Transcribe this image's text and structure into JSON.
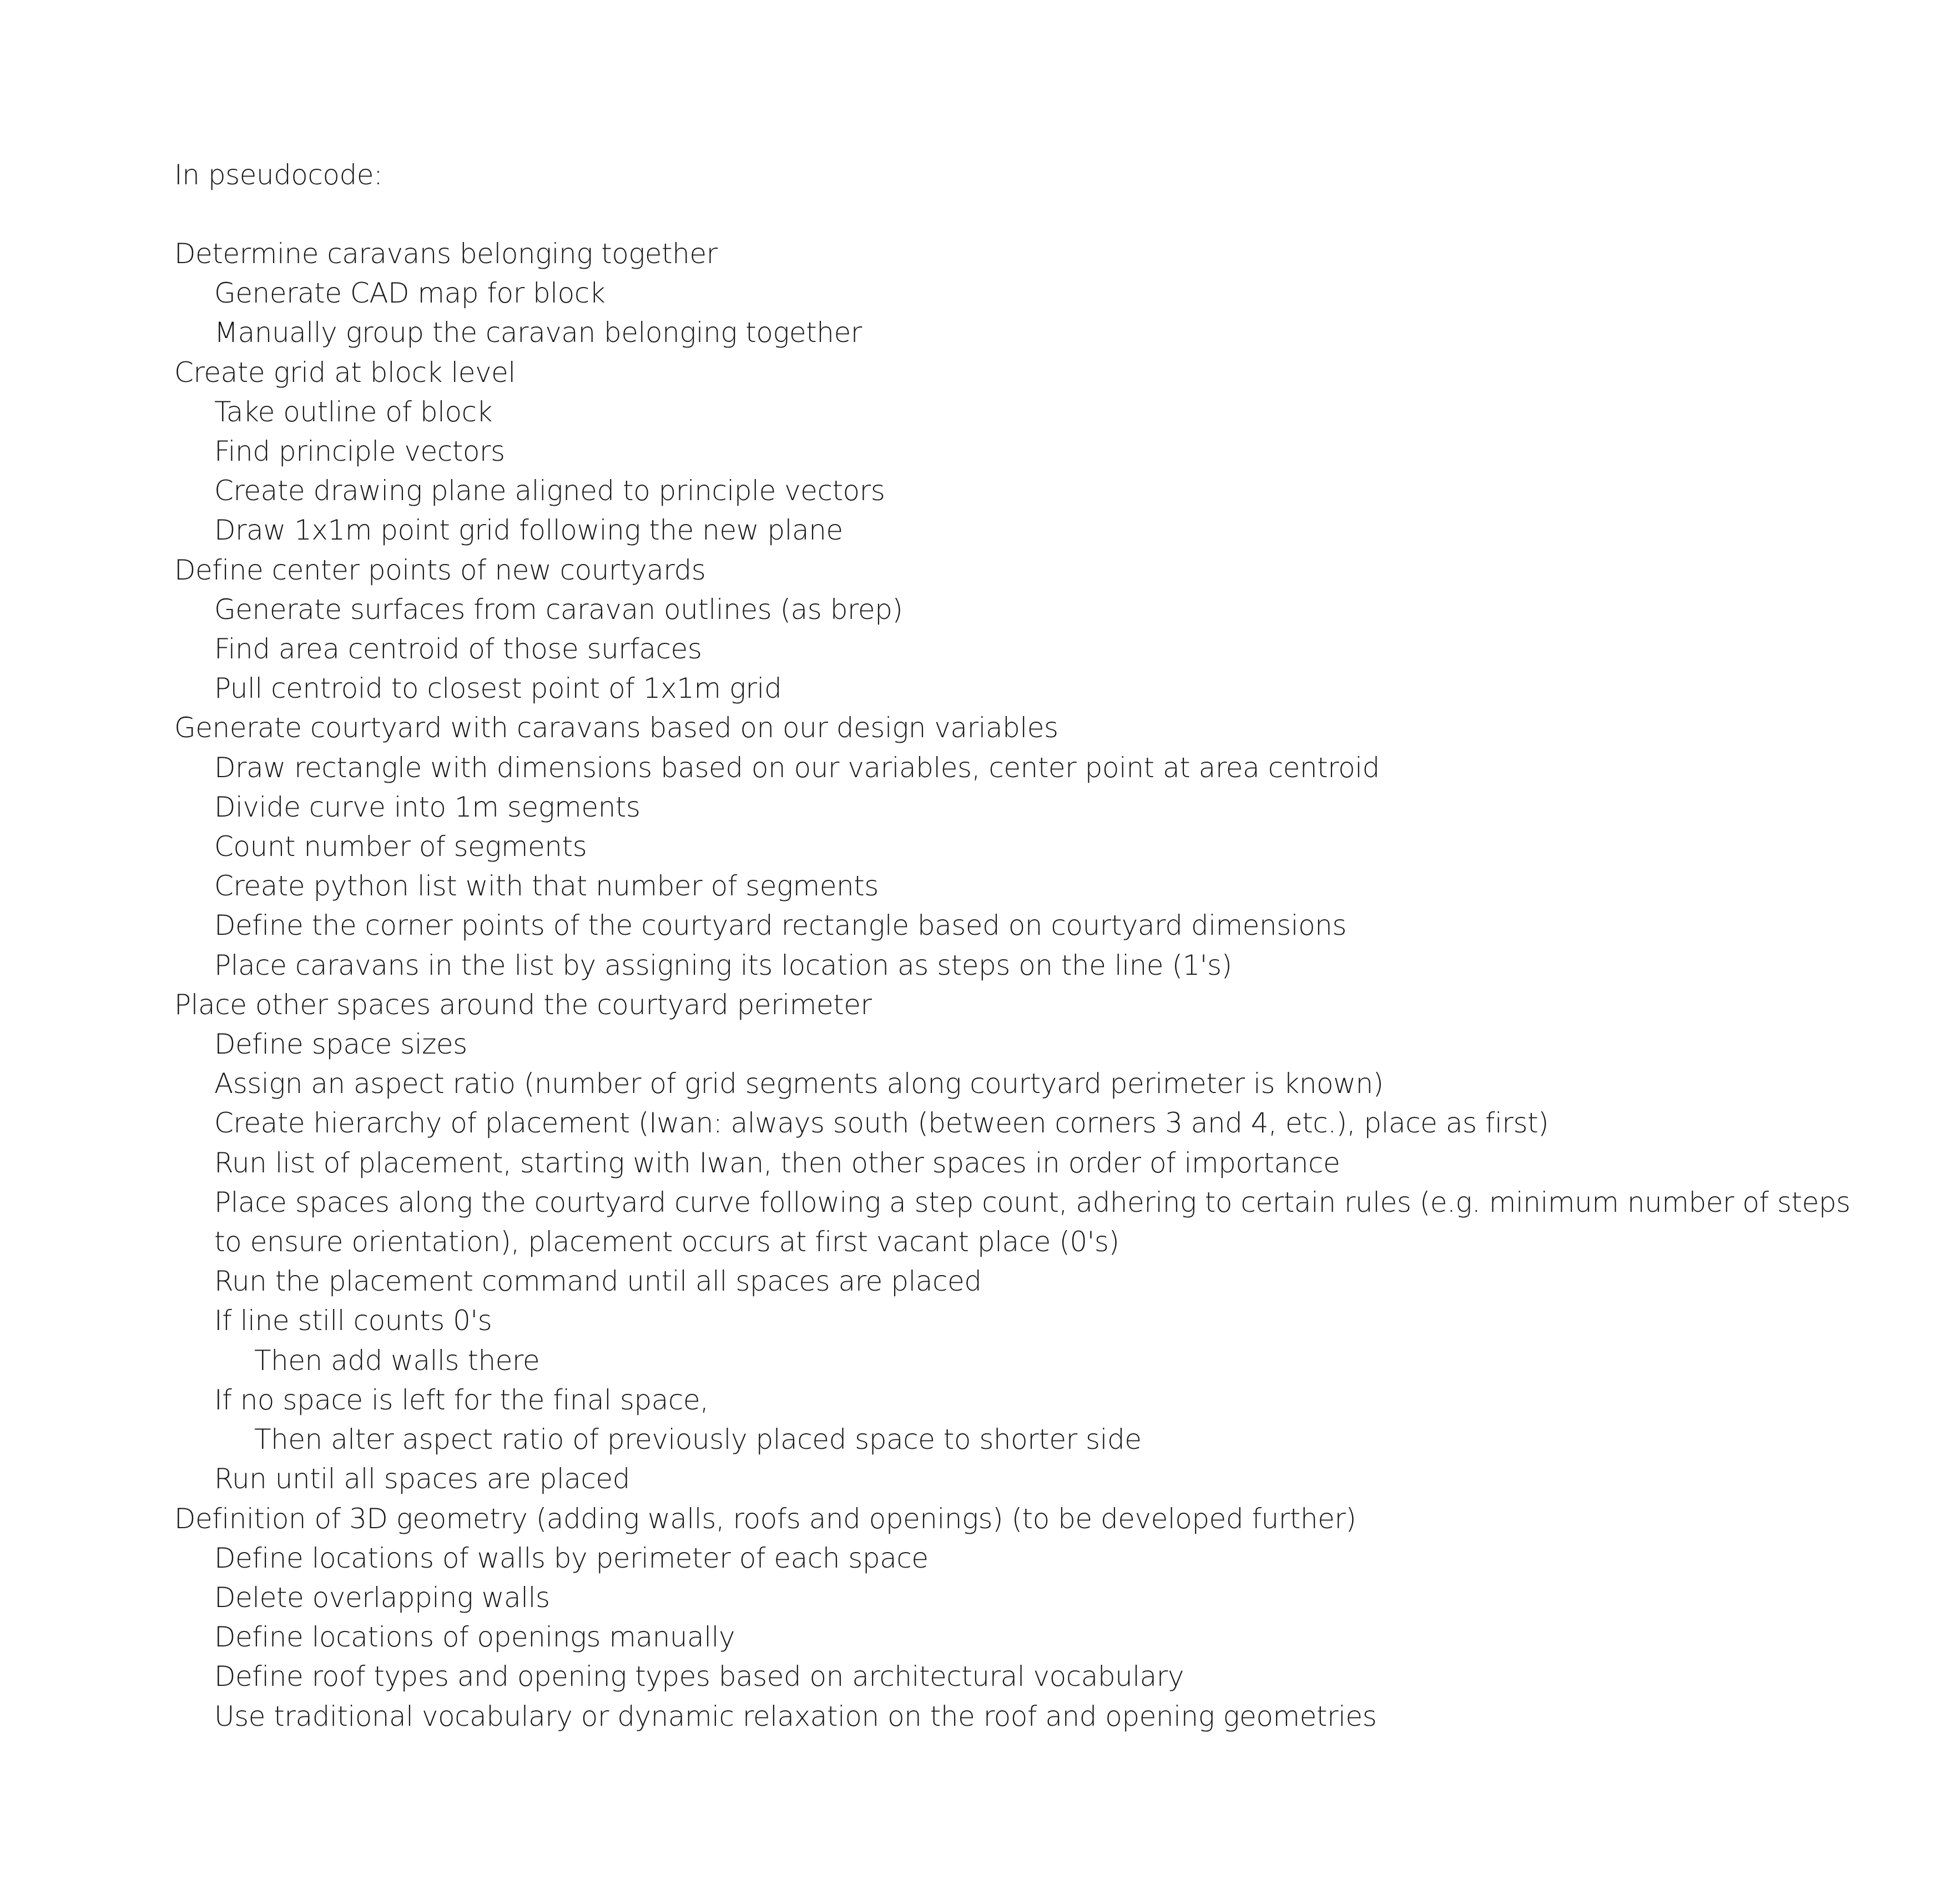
{
  "document": {
    "heading": "In pseudocode:",
    "lines": [
      {
        "level": 0,
        "text": "Determine caravans belonging together"
      },
      {
        "level": 1,
        "text": "Generate CAD map for block"
      },
      {
        "level": 1,
        "text": "Manually group the caravan belonging together"
      },
      {
        "level": 0,
        "text": "Create grid at block level"
      },
      {
        "level": 1,
        "text": "Take outline of block"
      },
      {
        "level": 1,
        "text": "Find principle vectors"
      },
      {
        "level": 1,
        "text": "Create drawing plane aligned to principle vectors"
      },
      {
        "level": 1,
        "text": "Draw 1x1m point grid following the new plane"
      },
      {
        "level": 0,
        "text": "Define center points of new courtyards"
      },
      {
        "level": 1,
        "text": "Generate surfaces from caravan outlines (as brep)"
      },
      {
        "level": 1,
        "text": "Find area centroid of those surfaces"
      },
      {
        "level": 1,
        "text": "Pull centroid to closest point of 1x1m grid"
      },
      {
        "level": 0,
        "text": "Generate courtyard with caravans based on our design variables"
      },
      {
        "level": 1,
        "text": "Draw rectangle with dimensions based on our variables, center point at area centroid"
      },
      {
        "level": 1,
        "text": "Divide curve into 1m segments"
      },
      {
        "level": 1,
        "text": "Count number of segments"
      },
      {
        "level": 1,
        "text": "Create python list with that number of segments"
      },
      {
        "level": 1,
        "text": "Define the corner points of the courtyard rectangle based on courtyard dimensions"
      },
      {
        "level": 1,
        "text": "Place caravans in the list by assigning its location as steps on the line (1's)"
      },
      {
        "level": 0,
        "text": "Place other spaces around the courtyard perimeter"
      },
      {
        "level": 1,
        "text": "Define space sizes"
      },
      {
        "level": 1,
        "text": "Assign an aspect ratio (number of grid segments along courtyard perimeter is known)"
      },
      {
        "level": 1,
        "text": "Create hierarchy of placement (Iwan: always south (between corners 3 and 4, etc.), place as first)"
      },
      {
        "level": 1,
        "text": "Run list of placement, starting with Iwan, then other spaces in order of importance"
      },
      {
        "level": 1,
        "text": "Place spaces along the courtyard curve following a step count, adhering to certain rules (e.g. minimum number of steps"
      },
      {
        "level": 1,
        "text": "to ensure orientation), placement occurs at first vacant place (0's)"
      },
      {
        "level": 1,
        "text": "Run the placement command until all spaces are placed"
      },
      {
        "level": 1,
        "text": "If line still counts 0's"
      },
      {
        "level": 2,
        "text": "Then add walls there"
      },
      {
        "level": 1,
        "text": "If no space is left for the final space,"
      },
      {
        "level": 2,
        "text": "Then alter aspect ratio of previously placed space to shorter side"
      },
      {
        "level": 1,
        "text": "Run until all spaces are placed"
      },
      {
        "level": 0,
        "text": "Definition of 3D geometry (adding walls, roofs and openings) (to be developed further)"
      },
      {
        "level": 1,
        "text": "Define locations of walls by perimeter of each space"
      },
      {
        "level": 1,
        "text": "Delete overlapping walls"
      },
      {
        "level": 1,
        "text": "Define locations of openings manually"
      },
      {
        "level": 1,
        "text": "Define roof types and opening types based on architectural vocabulary"
      },
      {
        "level": 1,
        "text": "Use traditional vocabulary or dynamic relaxation on the roof and opening geometries"
      }
    ]
  }
}
